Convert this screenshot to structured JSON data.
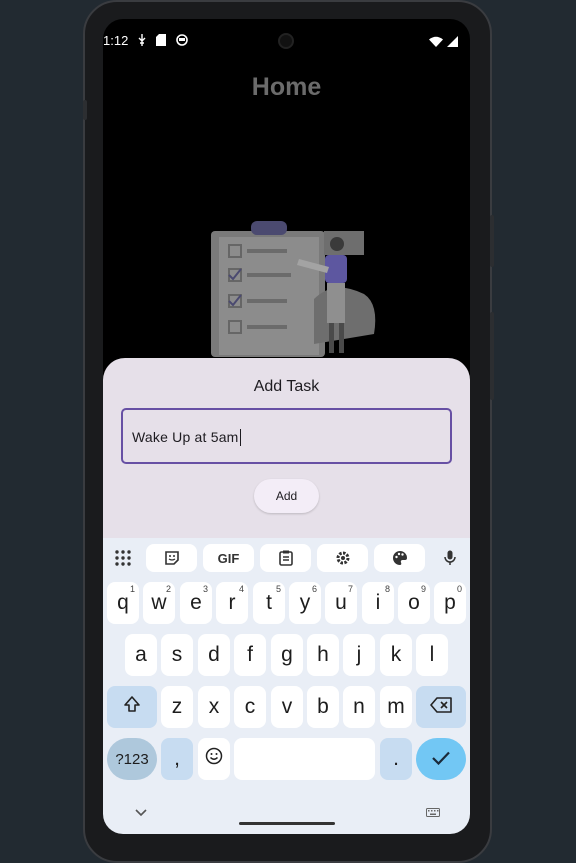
{
  "status": {
    "time": "1:12"
  },
  "page": {
    "title": "Home"
  },
  "dialog": {
    "title": "Add Task",
    "input_value": "Wake Up at 5am",
    "add_label": "Add"
  },
  "keyboard": {
    "toolbar": [
      "apps-grid-icon",
      "sticker-icon",
      "GIF",
      "clipboard-icon",
      "settings-icon",
      "palette-icon",
      "mic-icon"
    ],
    "row1": [
      {
        "k": "q",
        "h": "1"
      },
      {
        "k": "w",
        "h": "2"
      },
      {
        "k": "e",
        "h": "3"
      },
      {
        "k": "r",
        "h": "4"
      },
      {
        "k": "t",
        "h": "5"
      },
      {
        "k": "y",
        "h": "6"
      },
      {
        "k": "u",
        "h": "7"
      },
      {
        "k": "i",
        "h": "8"
      },
      {
        "k": "o",
        "h": "9"
      },
      {
        "k": "p",
        "h": "0"
      }
    ],
    "row2": [
      "a",
      "s",
      "d",
      "f",
      "g",
      "h",
      "j",
      "k",
      "l"
    ],
    "row3": [
      "z",
      "x",
      "c",
      "v",
      "b",
      "n",
      "m"
    ],
    "symbols_label": "?123",
    "comma": ",",
    "period": "."
  },
  "colors": {
    "accent": "#6750a4",
    "sheet": "#e6e0e9",
    "enter": "#72c7f4"
  }
}
